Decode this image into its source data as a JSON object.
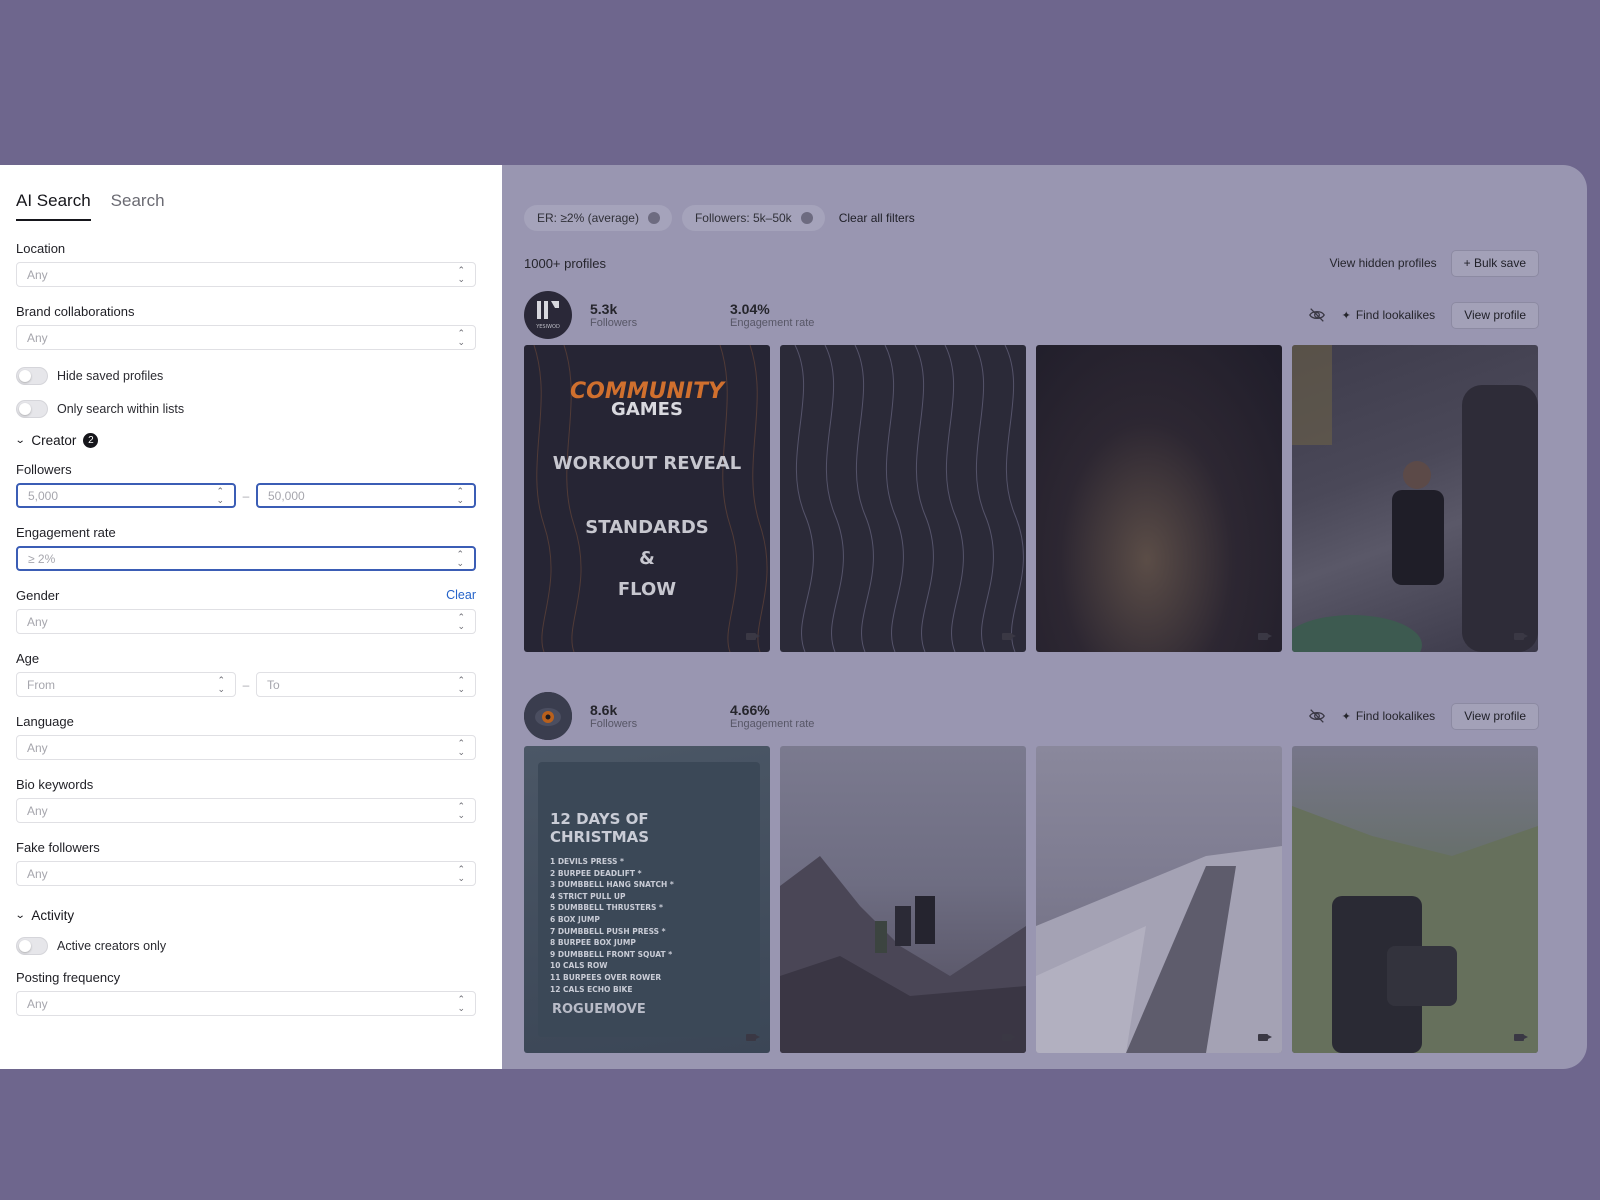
{
  "sidebar": {
    "tabs": [
      "AI Search",
      "Search"
    ],
    "location": {
      "label": "Location",
      "value": "Any"
    },
    "brand_collabs": {
      "label": "Brand collaborations",
      "value": "Any"
    },
    "toggles": [
      "Hide saved profiles",
      "Only search within lists"
    ],
    "creator": {
      "title": "Creator",
      "badge": "2",
      "followers": {
        "label": "Followers",
        "from": "5,000",
        "to": "50,000",
        "sep": "–"
      },
      "engagement": {
        "label": "Engagement rate",
        "value": "≥ 2%"
      },
      "gender": {
        "label": "Gender",
        "clear": "Clear",
        "value": "Any"
      },
      "age": {
        "label": "Age",
        "from": "From",
        "to": "To",
        "sep": "–"
      },
      "language": {
        "label": "Language",
        "value": "Any"
      },
      "bio": {
        "label": "Bio keywords",
        "value": "Any"
      },
      "fake": {
        "label": "Fake followers",
        "value": "Any"
      }
    },
    "activity": {
      "title": "Activity",
      "toggle": "Active creators only",
      "posting": {
        "label": "Posting frequency",
        "value": "Any"
      }
    }
  },
  "main": {
    "chips": [
      "ER: ≥2% (average)",
      "Followers: 5k–50k"
    ],
    "clear_all": "Clear all filters",
    "count": "1000+ profiles",
    "view_hidden": "View hidden profiles",
    "bulk_save": "+ Bulk save",
    "find_lookalikes": "Find lookalikes",
    "view_profile": "View profile",
    "profiles": [
      {
        "avatar_text": "YESIWOD",
        "followers": "5.3k",
        "followers_label": "Followers",
        "er": "3.04%",
        "er_label": "Engagement rate"
      },
      {
        "avatar_text": "",
        "followers": "8.6k",
        "followers_label": "Followers",
        "er": "4.66%",
        "er_label": "Engagement rate"
      }
    ],
    "posters": {
      "games_1": "COMMUNITY",
      "games_2": "GAMES",
      "games_3": "WORKOUT REVEAL",
      "games_4": "STANDARDS",
      "games_5": "&",
      "games_6": "FLOW",
      "xmas_title": "12 DAYS OF CHRISTMAS",
      "xmas_items": [
        "1 DEVILS PRESS *",
        "2 BURPEE DEADLIFT *",
        "3 DUMBBELL HANG SNATCH *",
        "4 STRICT PULL UP",
        "5 DUMBBELL THRUSTERS *",
        "6 BOX JUMP",
        "7 DUMBBELL PUSH PRESS *",
        "8 BURPEE BOX JUMP",
        "9 DUMBBELL FRONT SQUAT *",
        "10 CALS ROW",
        "11 BURPEES OVER ROWER",
        "12 CALS ECHO BIKE"
      ],
      "xmas_brand": "ROGUEMOVE"
    }
  }
}
